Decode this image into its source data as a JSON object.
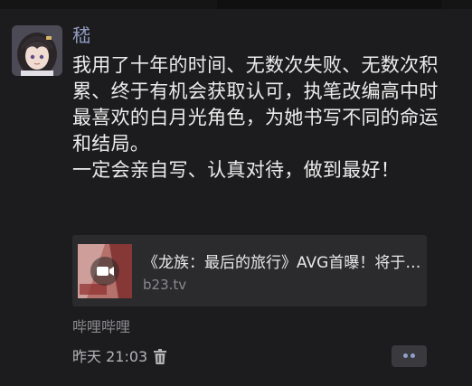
{
  "post": {
    "username": "嵇",
    "text": "我用了十年的时间、无数次失败、无数次积累、终于有机会获取认可，执笔改编高中时最喜欢的白月光角色，为她书写不同的命运和结局。\n一定会亲自写、认真对待，做到最好！",
    "link_card": {
      "title": "《龙族：最后的旅行》AVG首曝！将于…",
      "domain": "b23.tv"
    },
    "source": "哔哩哔哩",
    "timestamp": "昨天 21:03"
  },
  "icons": {
    "avatar": "avatar-anime-girl",
    "delete": "trash-icon",
    "more": "more-dots-icon",
    "video": "video-camera-icon"
  },
  "colors": {
    "background": "#1c1c1e",
    "username": "#8f9bbf",
    "card_bg": "#2b2b2e",
    "muted_text": "#8a8a8e",
    "accent_dots": "#8fa0c8"
  }
}
